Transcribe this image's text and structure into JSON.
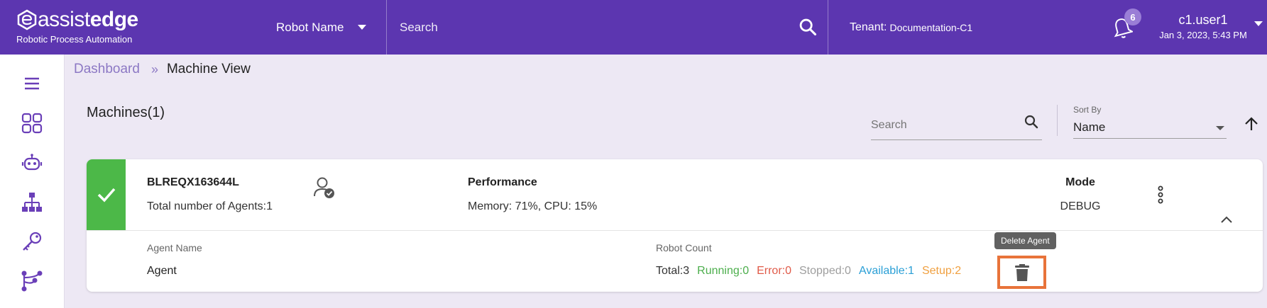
{
  "header": {
    "logo_prefix": "assist",
    "logo_suffix": "edge",
    "logo_tagline": "Robotic Process Automation",
    "robot_select": "Robot Name",
    "search_placeholder": "Search",
    "tenant_label": "Tenant:",
    "tenant_value": "Documentation-C1",
    "notification_count": "6",
    "user_name": "c1.user1",
    "user_datetime": "Jan 3, 2023, 5:43 PM"
  },
  "sidebar": {
    "icons": [
      "menu-icon",
      "dashboard-grid-icon",
      "robot-icon",
      "hierarchy-icon",
      "key-icon",
      "workflow-icon"
    ]
  },
  "breadcrumb": {
    "parent": "Dashboard",
    "current": "Machine View"
  },
  "machines": {
    "title": "Machines(1)",
    "search_placeholder": "Search",
    "sort_label": "Sort By",
    "sort_value": "Name"
  },
  "machine_card": {
    "status": "online",
    "name": "BLREQX163644L",
    "agents_count_text": "Total number of Agents:1",
    "performance_label": "Performance",
    "performance_value": "Memory: 71%, CPU: 15%",
    "mode_label": "Mode",
    "mode_value": "DEBUG",
    "agent_name_label": "Agent Name",
    "agent_name": "Agent",
    "robot_count_label": "Robot Count",
    "counts": {
      "total": "Total:3",
      "running": "Running:0",
      "error": "Error:0",
      "stopped": "Stopped:0",
      "available": "Available:1",
      "setup": "Setup:2"
    },
    "delete_tooltip": "Delete Agent"
  },
  "colors": {
    "header_bg": "#5c36b0",
    "page_bg": "#ede8f4",
    "status_green": "#4cb848",
    "accent_purple": "#6a3fb8",
    "highlight_orange": "#e8733a"
  }
}
